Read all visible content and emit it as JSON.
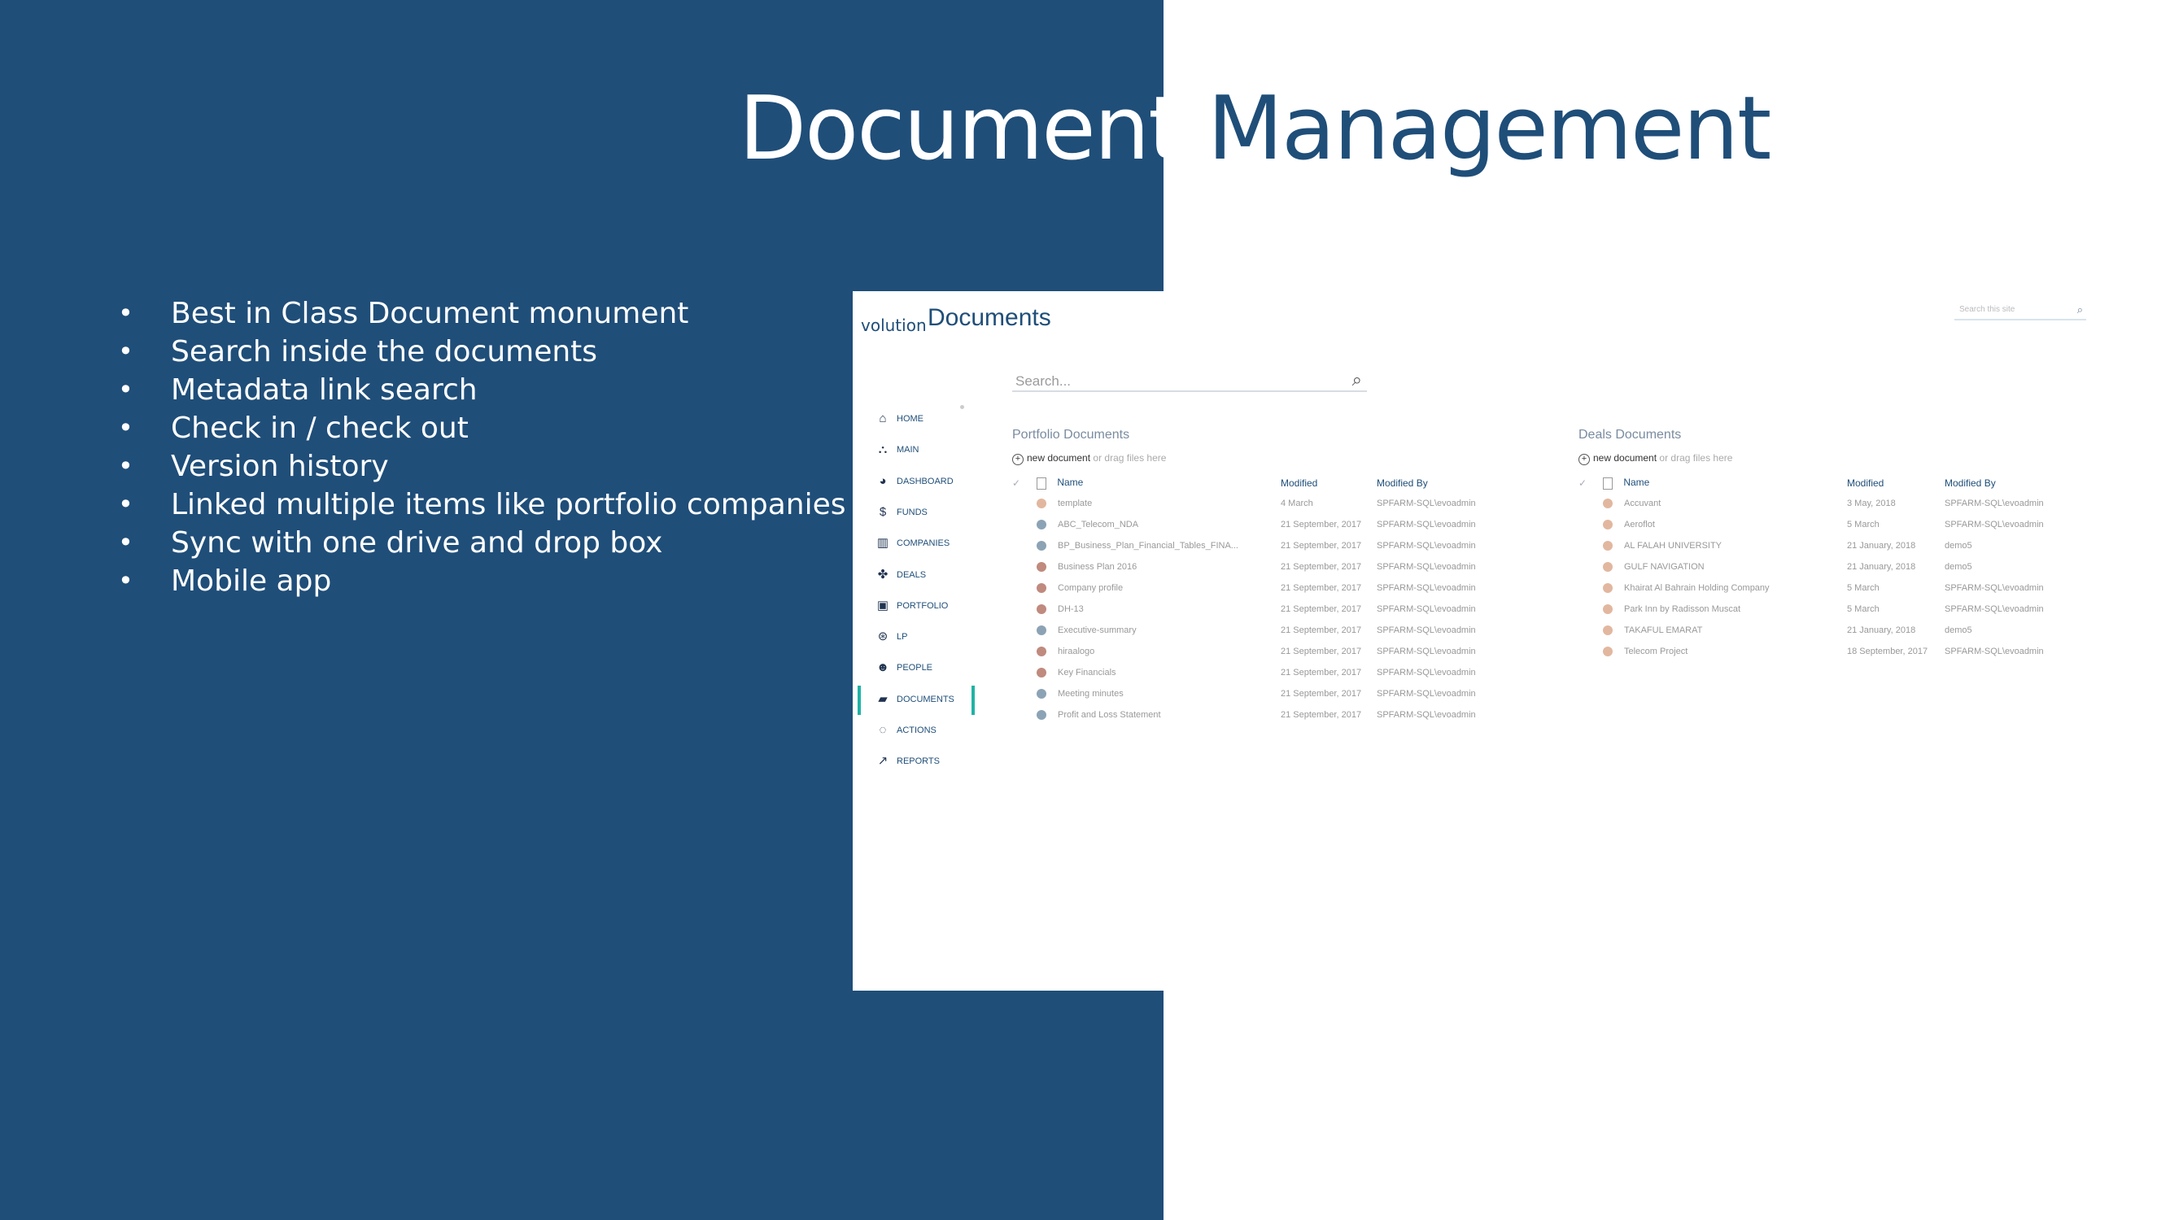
{
  "slide": {
    "title_part1": "Document ",
    "title_part2": "Management",
    "bullets": [
      "Best in Class Document monument",
      "Search inside the documents",
      "Metadata link search",
      "Check in / check out",
      "Version history",
      "Linked multiple items like portfolio companies",
      "Sync with one drive and drop box",
      "Mobile app"
    ]
  },
  "app": {
    "logo_text": "volution",
    "title": "Documents",
    "top_search_placeholder": "Search this site",
    "search_placeholder": "Search...",
    "nav": [
      {
        "label": "HOME",
        "icon": "home-icon",
        "glyph": "⌂",
        "active": false
      },
      {
        "label": "MAIN",
        "icon": "sitemap-icon",
        "glyph": "⛬",
        "active": false
      },
      {
        "label": "DASHBOARD",
        "icon": "dashboard-icon",
        "glyph": "◕",
        "active": false
      },
      {
        "label": "FUNDS",
        "icon": "dollar-icon",
        "glyph": "$",
        "active": false
      },
      {
        "label": "COMPANIES",
        "icon": "building-icon",
        "glyph": "▥",
        "active": false
      },
      {
        "label": "DEALS",
        "icon": "handshake-icon",
        "glyph": "✤",
        "active": false
      },
      {
        "label": "PORTFOLIO",
        "icon": "portfolio-icon",
        "glyph": "▣",
        "active": false
      },
      {
        "label": "LP",
        "icon": "lp-icon",
        "glyph": "⊛",
        "active": false
      },
      {
        "label": "PEOPLE",
        "icon": "people-icon",
        "glyph": "☻",
        "active": false
      },
      {
        "label": "DOCUMENTS",
        "icon": "folder-open-icon",
        "glyph": "▰",
        "active": true
      },
      {
        "label": "ACTIONS",
        "icon": "comments-icon",
        "glyph": "◌",
        "active": false
      },
      {
        "label": "REPORTS",
        "icon": "chart-line-icon",
        "glyph": "↗",
        "active": false
      }
    ],
    "portfolio": {
      "title": "Portfolio Documents",
      "new_doc": "new document",
      "drag_text": "or drag files here",
      "headers": {
        "name": "Name",
        "modified": "Modified",
        "modified_by": "Modified By"
      },
      "rows": [
        {
          "name": "template",
          "modified": "4 March",
          "by": "SPFARM-SQL\\evoadmin",
          "type": "xls"
        },
        {
          "name": "ABC_Telecom_NDA",
          "modified": "21 September, 2017",
          "by": "SPFARM-SQL\\evoadmin",
          "type": "blue"
        },
        {
          "name": "BP_Business_Plan_Financial_Tables_FINA...",
          "modified": "21 September, 2017",
          "by": "SPFARM-SQL\\evoadmin",
          "type": "blue"
        },
        {
          "name": "Business Plan 2016",
          "modified": "21 September, 2017",
          "by": "SPFARM-SQL\\evoadmin",
          "type": "pdf"
        },
        {
          "name": "Company profile",
          "modified": "21 September, 2017",
          "by": "SPFARM-SQL\\evoadmin",
          "type": "pdf"
        },
        {
          "name": "DH-13",
          "modified": "21 September, 2017",
          "by": "SPFARM-SQL\\evoadmin",
          "type": "pdf"
        },
        {
          "name": "Executive-summary",
          "modified": "21 September, 2017",
          "by": "SPFARM-SQL\\evoadmin",
          "type": "blue"
        },
        {
          "name": "hiraalogo",
          "modified": "21 September, 2017",
          "by": "SPFARM-SQL\\evoadmin",
          "type": "pdf"
        },
        {
          "name": "Key Financials",
          "modified": "21 September, 2017",
          "by": "SPFARM-SQL\\evoadmin",
          "type": "pdf"
        },
        {
          "name": "Meeting minutes",
          "modified": "21 September, 2017",
          "by": "SPFARM-SQL\\evoadmin",
          "type": "blue"
        },
        {
          "name": "Profit and Loss Statement",
          "modified": "21 September, 2017",
          "by": "SPFARM-SQL\\evoadmin",
          "type": "blue"
        }
      ]
    },
    "deals": {
      "title": "Deals Documents",
      "new_doc": "new document",
      "drag_text": "or drag files here",
      "headers": {
        "name": "Name",
        "modified": "Modified",
        "modified_by": "Modified By"
      },
      "rows": [
        {
          "name": "Accuvant",
          "modified": "3 May, 2018",
          "by": "SPFARM-SQL\\evoadmin",
          "type": "xls"
        },
        {
          "name": "Aeroflot",
          "modified": "5 March",
          "by": "SPFARM-SQL\\evoadmin",
          "type": "xls"
        },
        {
          "name": "AL FALAH UNIVERSITY",
          "modified": "21 January, 2018",
          "by": "demo5",
          "type": "xls"
        },
        {
          "name": "GULF NAVIGATION",
          "modified": "21 January, 2018",
          "by": "demo5",
          "type": "xls"
        },
        {
          "name": "Khairat Al Bahrain Holding Company",
          "modified": "5 March",
          "by": "SPFARM-SQL\\evoadmin",
          "type": "xls"
        },
        {
          "name": "Park Inn by Radisson Muscat",
          "modified": "5 March",
          "by": "SPFARM-SQL\\evoadmin",
          "type": "xls"
        },
        {
          "name": "TAKAFUL EMARAT",
          "modified": "21 January, 2018",
          "by": "demo5",
          "type": "xls"
        },
        {
          "name": "Telecom Project",
          "modified": "18 September, 2017",
          "by": "SPFARM-SQL\\evoadmin",
          "type": "xls"
        }
      ]
    }
  },
  "colors": {
    "brand": "#1f4e79",
    "active": "#1fb3a6"
  }
}
